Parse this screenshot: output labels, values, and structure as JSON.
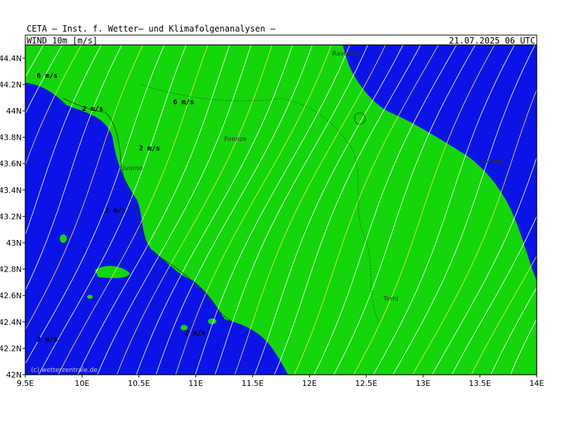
{
  "header": {
    "institution": "CETA — Inst. f. Wetter— und Klimafolgenanalysen —",
    "variable": "WIND 10m [m/s]",
    "datetime": "21.07.2025 06 UTC"
  },
  "map": {
    "lon_range": [
      9.5,
      14.0
    ],
    "lat_range": [
      42.0,
      44.5
    ],
    "x_ticks": [
      "9.5E",
      "10E",
      "10.5E",
      "11E",
      "11.5E",
      "12E",
      "12.5E",
      "13E",
      "13.5E",
      "14E"
    ],
    "y_ticks": [
      "42N",
      "42.2N",
      "42.4N",
      "42.6N",
      "42.8N",
      "43N",
      "43.2N",
      "43.4N",
      "43.6N",
      "43.8N",
      "44N",
      "44.2N",
      "44.4N"
    ],
    "colors": {
      "low_wind_fill": "#0a14e6",
      "high_wind_fill": "#14d60a",
      "streamline": "#ffffff",
      "streamline_strong": "#f5e27a",
      "land_border": "#1a3a1a"
    },
    "cities": [
      {
        "name": "Ravenna",
        "lon": 12.2,
        "lat": 44.42
      },
      {
        "name": "Firenze",
        "lon": 11.25,
        "lat": 43.77
      },
      {
        "name": "Livorno",
        "lon": 10.33,
        "lat": 43.55
      },
      {
        "name": "Ancona",
        "lon": 13.5,
        "lat": 43.6
      },
      {
        "name": "Terni",
        "lon": 12.65,
        "lat": 42.56
      }
    ],
    "contour_labels": [
      {
        "text": "6 m/s",
        "lon": 9.6,
        "lat": 44.25
      },
      {
        "text": "6 m/s",
        "lon": 10.8,
        "lat": 44.05
      },
      {
        "text": "2 m/s",
        "lon": 10.0,
        "lat": 44.0
      },
      {
        "text": "2 m/s",
        "lon": 10.5,
        "lat": 43.7
      },
      {
        "text": "2 m/s",
        "lon": 10.2,
        "lat": 43.23
      },
      {
        "text": "2 m/s",
        "lon": 10.9,
        "lat": 42.3
      },
      {
        "text": "2 m/s",
        "lon": 9.6,
        "lat": 42.25
      }
    ],
    "footer_credit": "(c) wetterzentrale.de"
  }
}
